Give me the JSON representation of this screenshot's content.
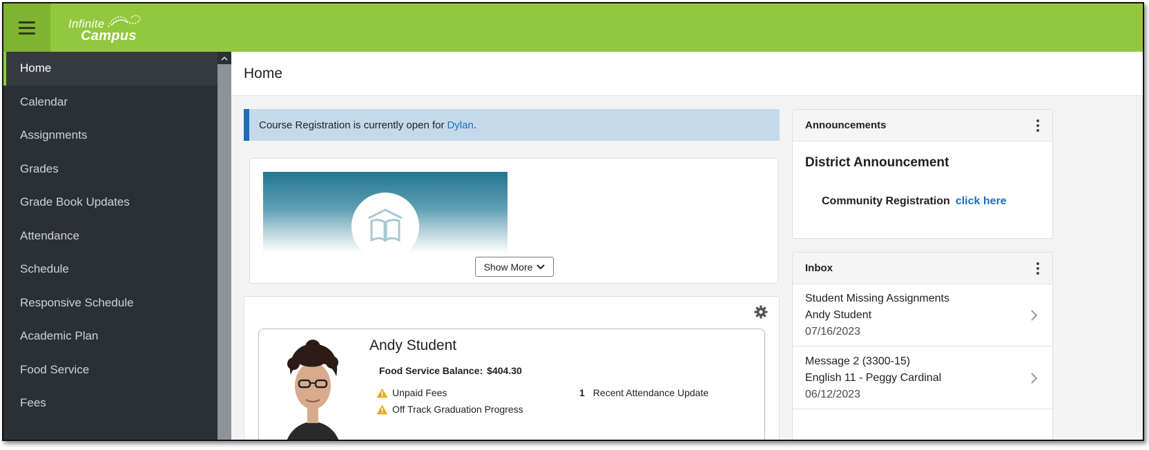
{
  "app": {
    "logo_line1": "Infinite",
    "logo_line2": "Campus",
    "brand_color": "#93c83e"
  },
  "sidebar": {
    "items": [
      {
        "label": "Home",
        "active": true
      },
      {
        "label": "Calendar"
      },
      {
        "label": "Assignments"
      },
      {
        "label": "Grades"
      },
      {
        "label": "Grade Book Updates"
      },
      {
        "label": "Attendance"
      },
      {
        "label": "Schedule"
      },
      {
        "label": "Responsive Schedule"
      },
      {
        "label": "Academic Plan"
      },
      {
        "label": "Food Service"
      },
      {
        "label": "Fees"
      }
    ]
  },
  "page": {
    "title": "Home"
  },
  "banner": {
    "text": "Course Registration is currently open for",
    "link": "Dylan",
    "suffix": "."
  },
  "course_card": {
    "show_more": "Show More"
  },
  "student": {
    "name": "Andy Student",
    "balance_label": "Food Service Balance:",
    "balance_value": "$404.30",
    "alerts": [
      "Unpaid Fees",
      "Off Track Graduation Progress"
    ],
    "attendance_count": "1",
    "attendance_label": "Recent Attendance Update"
  },
  "announcements": {
    "header": "Announcements",
    "title": "District Announcement",
    "line": "Community Registration",
    "link": "click here"
  },
  "inbox": {
    "header": "Inbox",
    "messages": [
      {
        "title": "Student Missing Assignments",
        "subtitle": "Andy Student",
        "date": "07/16/2023"
      },
      {
        "title": "Message 2 (3300-15)",
        "subtitle": "English 11 - Peggy Cardinal",
        "date": "06/12/2023"
      }
    ]
  }
}
